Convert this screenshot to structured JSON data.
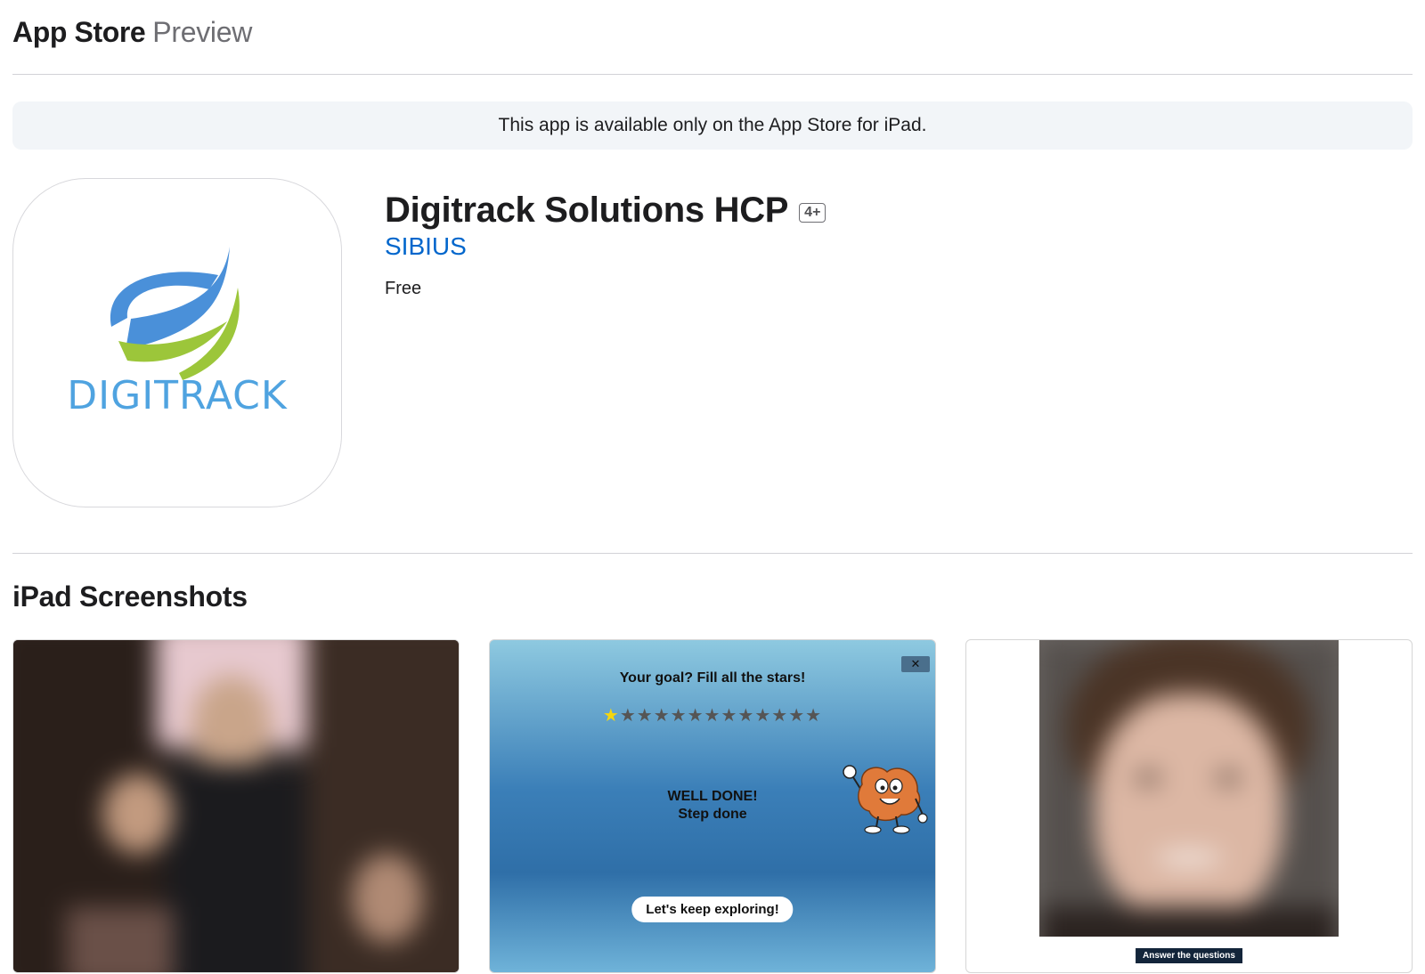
{
  "header": {
    "brand": "App Store",
    "subtitle": "Preview"
  },
  "banner": {
    "text": "This app is available only on the App Store for iPad."
  },
  "app": {
    "icon_wordmark": "DIGITRACK",
    "title": "Digitrack Solutions HCP",
    "age_rating": "4+",
    "developer": "SIBIUS",
    "price": "Free"
  },
  "screenshots_section": {
    "title": "iPad Screenshots",
    "screenshot2": {
      "goal": "Your goal? Fill all the stars!",
      "stars_filled": 1,
      "stars_total": 13,
      "close_label": "✕",
      "done_line1": "WELL DONE!",
      "done_line2": "Step done",
      "button_label": "Let's keep exploring!"
    },
    "screenshot3": {
      "caption": "Answer the questions"
    }
  },
  "colors": {
    "accent_link": "#0066cc",
    "icon_blue": "#4a90d9",
    "icon_green": "#9cc63a",
    "star_on": "#f5d60f"
  }
}
